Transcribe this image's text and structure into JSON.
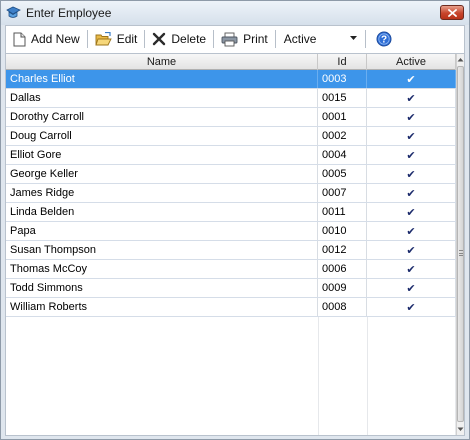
{
  "window": {
    "title": "Enter Employee",
    "accent_color": "#3d95ea"
  },
  "toolbar": {
    "add_new_label": "Add New",
    "edit_label": "Edit",
    "delete_label": "Delete",
    "print_label": "Print",
    "filter_value": "Active",
    "help_icon": "help-icon"
  },
  "grid": {
    "columns": [
      "Name",
      "Id",
      "Active"
    ],
    "selected_index": 0,
    "rows": [
      {
        "name": "Charles Elliot",
        "id": "0003",
        "active": "✔"
      },
      {
        "name": "Dallas",
        "id": "0015",
        "active": "✔"
      },
      {
        "name": "Dorothy Carroll",
        "id": "0001",
        "active": "✔"
      },
      {
        "name": "Doug Carroll",
        "id": "0002",
        "active": "✔"
      },
      {
        "name": "Elliot Gore",
        "id": "0004",
        "active": "✔"
      },
      {
        "name": "George Keller",
        "id": "0005",
        "active": "✔"
      },
      {
        "name": "James Ridge",
        "id": "0007",
        "active": "✔"
      },
      {
        "name": "Linda Belden",
        "id": "0011",
        "active": "✔"
      },
      {
        "name": "Papa",
        "id": "0010",
        "active": "✔"
      },
      {
        "name": "Susan Thompson",
        "id": "0012",
        "active": "✔"
      },
      {
        "name": "Thomas McCoy",
        "id": "0006",
        "active": "✔"
      },
      {
        "name": "Todd Simmons",
        "id": "0009",
        "active": "✔"
      },
      {
        "name": "William Roberts",
        "id": "0008",
        "active": "✔"
      }
    ]
  }
}
